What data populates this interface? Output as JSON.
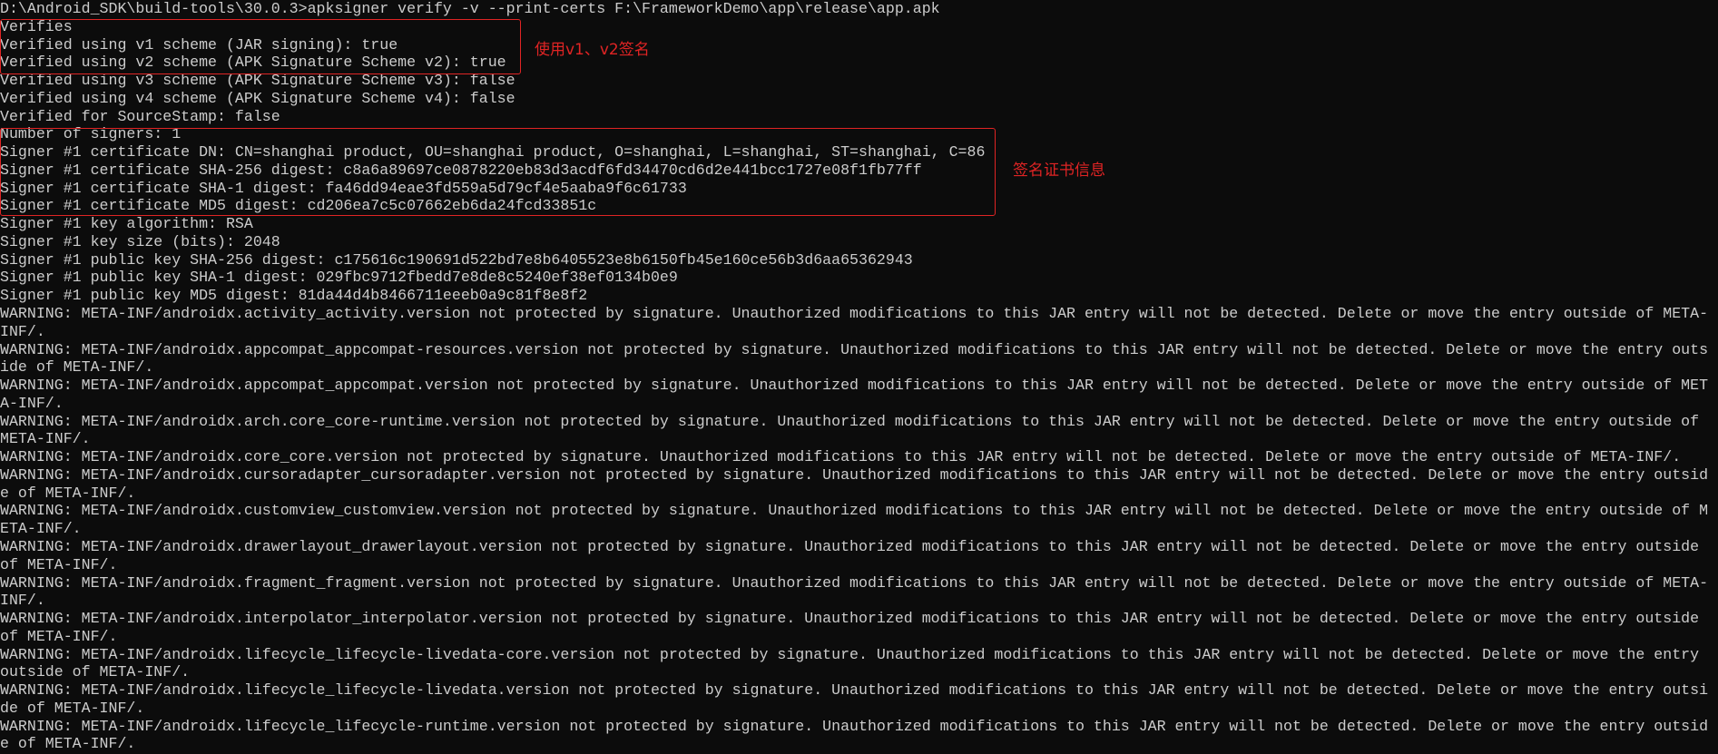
{
  "colors": {
    "background": "#0c0c0c",
    "text": "#cccccc",
    "highlight": "#e02424"
  },
  "terminal": {
    "command_line": "D:\\Android_SDK\\build-tools\\30.0.3>apksigner verify -v --print-certs F:\\FrameworkDemo\\app\\release\\app.apk",
    "output_lines": [
      "Verifies",
      "Verified using v1 scheme (JAR signing): true",
      "Verified using v2 scheme (APK Signature Scheme v2): true",
      "Verified using v3 scheme (APK Signature Scheme v3): false",
      "Verified using v4 scheme (APK Signature Scheme v4): false",
      "Verified for SourceStamp: false",
      "Number of signers: 1",
      "Signer #1 certificate DN: CN=shanghai product, OU=shanghai product, O=shanghai, L=shanghai, ST=shanghai, C=86",
      "Signer #1 certificate SHA-256 digest: c8a6a89697ce0878220eb83d3acdf6fd34470cd6d2e441bcc1727e08f1fb77ff",
      "Signer #1 certificate SHA-1 digest: fa46dd94eae3fd559a5d79cf4e5aaba9f6c61733",
      "Signer #1 certificate MD5 digest: cd206ea7c5c07662eb6da24fcd33851c",
      "Signer #1 key algorithm: RSA",
      "Signer #1 key size (bits): 2048",
      "Signer #1 public key SHA-256 digest: c175616c190691d522bd7e8b6405523e8b6150fb45e160ce56b3d6aa65362943",
      "Signer #1 public key SHA-1 digest: 029fbc9712fbedd7e8de8c5240ef38ef0134b0e9",
      "Signer #1 public key MD5 digest: 81da44d4b8466711eeeb0a9c81f8e8f2",
      "WARNING: META-INF/androidx.activity_activity.version not protected by signature. Unauthorized modifications to this JAR entry will not be detected. Delete or move the entry outside of META-",
      "INF/.",
      "WARNING: META-INF/androidx.appcompat_appcompat-resources.version not protected by signature. Unauthorized modifications to this JAR entry will not be detected. Delete or move the entry outs",
      "ide of META-INF/.",
      "WARNING: META-INF/androidx.appcompat_appcompat.version not protected by signature. Unauthorized modifications to this JAR entry will not be detected. Delete or move the entry outside of MET",
      "A-INF/.",
      "WARNING: META-INF/androidx.arch.core_core-runtime.version not protected by signature. Unauthorized modifications to this JAR entry will not be detected. Delete or move the entry outside of",
      "META-INF/.",
      "WARNING: META-INF/androidx.core_core.version not protected by signature. Unauthorized modifications to this JAR entry will not be detected. Delete or move the entry outside of META-INF/.",
      "WARNING: META-INF/androidx.cursoradapter_cursoradapter.version not protected by signature. Unauthorized modifications to this JAR entry will not be detected. Delete or move the entry outsid",
      "e of META-INF/.",
      "WARNING: META-INF/androidx.customview_customview.version not protected by signature. Unauthorized modifications to this JAR entry will not be detected. Delete or move the entry outside of M",
      "ETA-INF/.",
      "WARNING: META-INF/androidx.drawerlayout_drawerlayout.version not protected by signature. Unauthorized modifications to this JAR entry will not be detected. Delete or move the entry outside",
      "of META-INF/.",
      "WARNING: META-INF/androidx.fragment_fragment.version not protected by signature. Unauthorized modifications to this JAR entry will not be detected. Delete or move the entry outside of META-",
      "INF/.",
      "WARNING: META-INF/androidx.interpolator_interpolator.version not protected by signature. Unauthorized modifications to this JAR entry will not be detected. Delete or move the entry outside",
      "of META-INF/.",
      "WARNING: META-INF/androidx.lifecycle_lifecycle-livedata-core.version not protected by signature. Unauthorized modifications to this JAR entry will not be detected. Delete or move the entry",
      "outside of META-INF/.",
      "WARNING: META-INF/androidx.lifecycle_lifecycle-livedata.version not protected by signature. Unauthorized modifications to this JAR entry will not be detected. Delete or move the entry outsi",
      "de of META-INF/.",
      "WARNING: META-INF/androidx.lifecycle_lifecycle-runtime.version not protected by signature. Unauthorized modifications to this JAR entry will not be detected. Delete or move the entry outsid",
      "e of META-INF/."
    ]
  },
  "annotations": {
    "signing_schemes_label": "使用v1、v2签名",
    "certificate_info_label": "签名证书信息"
  }
}
